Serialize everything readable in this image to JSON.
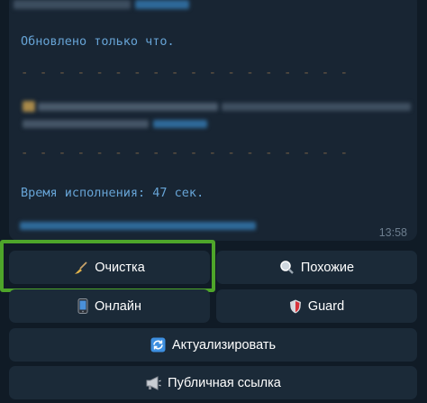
{
  "message": {
    "updated_text": "Обновлено только что.",
    "separator_top": "- - - - - - - - - - - - - - - - - -",
    "separator_bottom": "- - - - - - - - - - - - - - - - - -",
    "exec_time_text": "Время исполнения: 47 сек.",
    "timestamp": "13:58"
  },
  "keyboard": {
    "buttons": [
      {
        "label": "Очистка",
        "icon": "broom-icon"
      },
      {
        "label": "Похожие",
        "icon": "magnifier-icon"
      },
      {
        "label": "Онлайн",
        "icon": "mobile-phone-icon"
      },
      {
        "label": "Guard",
        "icon": "shield-icon"
      },
      {
        "label": "Актуализировать",
        "icon": "refresh-icon"
      },
      {
        "label": "Публичная ссылка",
        "icon": "megaphone-icon"
      }
    ]
  },
  "colors": {
    "background": "#101b26",
    "bubble": "#182533",
    "button": "#1b2a38",
    "highlight": "#4ea52a",
    "mono_text": "#67a4d6"
  }
}
